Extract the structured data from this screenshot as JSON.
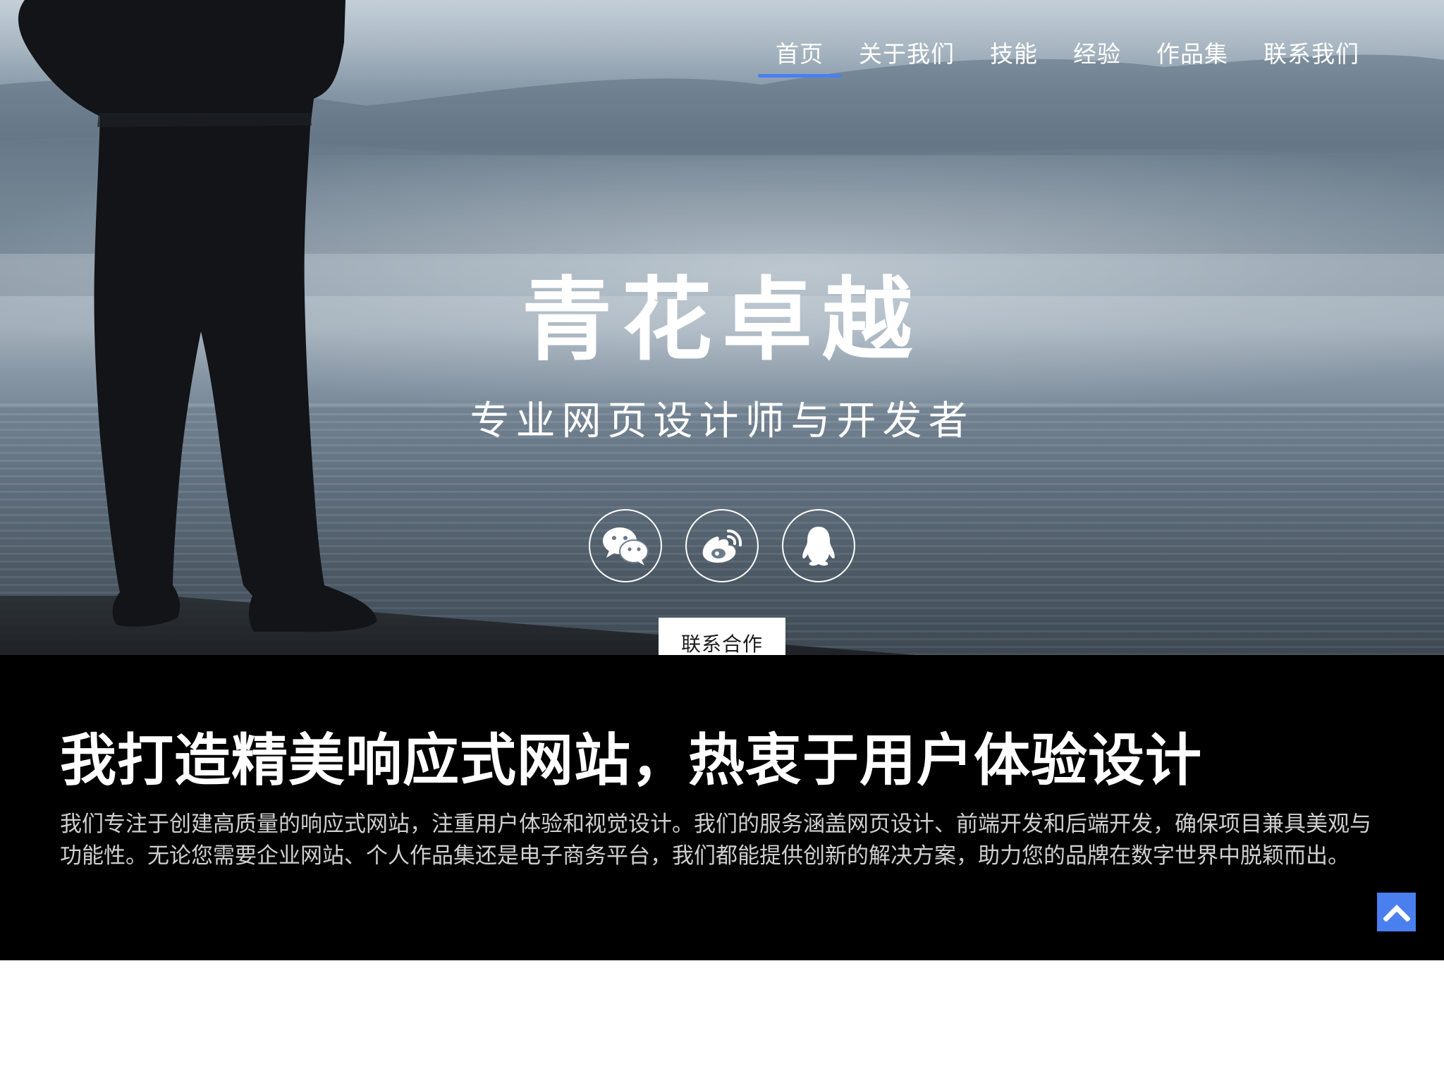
{
  "nav": {
    "items": [
      {
        "label": "首页",
        "active": true
      },
      {
        "label": "关于我们",
        "active": false
      },
      {
        "label": "技能",
        "active": false
      },
      {
        "label": "经验",
        "active": false
      },
      {
        "label": "作品集",
        "active": false
      },
      {
        "label": "联系我们",
        "active": false
      }
    ]
  },
  "hero": {
    "title": "青花卓越",
    "subtitle": "专业网页设计师与开发者",
    "social": [
      {
        "icon": "wechat-icon"
      },
      {
        "icon": "weibo-icon"
      },
      {
        "icon": "qq-icon"
      }
    ],
    "cta_label": "联系合作"
  },
  "about": {
    "heading": "我打造精美响应式网站，热衷于用户体验设计",
    "text": "我们专注于创建高质量的响应式网站，注重用户体验和视觉设计。我们的服务涵盖网页设计、前端开发和后端开发，确保项目兼具美观与功能性。无论您需要企业网站、个人作品集还是电子商务平台，我们都能提供创新的解决方案，助力您的品牌在数字世界中脱颖而出。"
  },
  "back_to_top": {
    "icon": "chevron-up-icon"
  },
  "colors": {
    "accent": "#4a7ff0",
    "section_bg": "#000000"
  }
}
